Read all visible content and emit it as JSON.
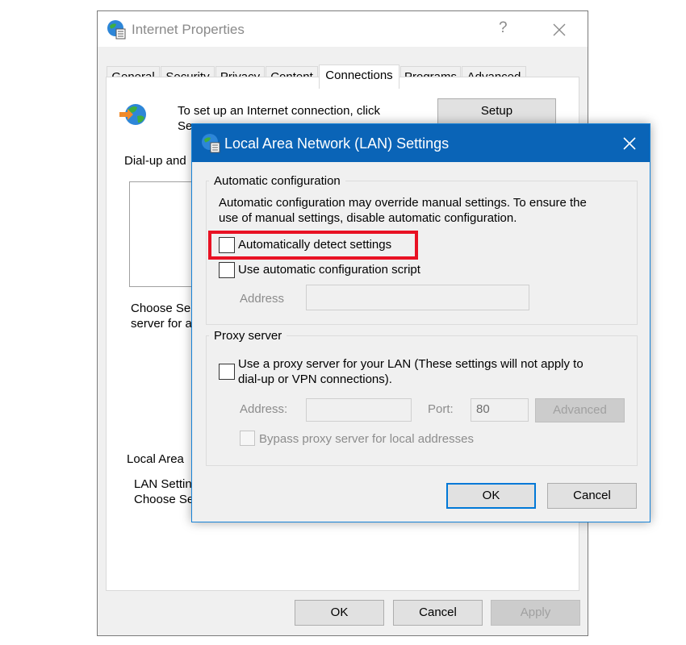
{
  "internet_properties": {
    "title": "Internet Properties",
    "help_glyph": "?",
    "tabs": [
      "General",
      "Security",
      "Privacy",
      "Content",
      "Connections",
      "Programs",
      "Advanced"
    ],
    "active_tab": "Connections",
    "setup_text_line1": "To set up an Internet connection, click",
    "setup_text_line2": "Se",
    "setup_button": "Setup",
    "dialup_label": "Dial-up and",
    "choose_text_line1": "Choose Se",
    "choose_text_line2": "server for a",
    "lan_section_label": "Local Area",
    "lan_text_line1": "LAN Settin",
    "lan_text_line2": "Choose Se",
    "ok_button": "OK",
    "cancel_button": "Cancel",
    "apply_button": "Apply"
  },
  "lan_dialog": {
    "title": "Local Area Network (LAN) Settings",
    "auto_config": {
      "legend": "Automatic configuration",
      "description_line1": "Automatic configuration may override manual settings.  To ensure the",
      "description_line2": "use of manual settings, disable automatic configuration.",
      "auto_detect_label": "Automatically detect settings",
      "auto_detect_checked": false,
      "auto_script_label": "Use automatic configuration script",
      "auto_script_checked": false,
      "address_label": "Address",
      "address_value": ""
    },
    "proxy": {
      "legend": "Proxy server",
      "use_proxy_line1": "Use a proxy server for your LAN (These settings will not apply to",
      "use_proxy_line2": "dial-up or VPN connections).",
      "use_proxy_checked": false,
      "address_label": "Address:",
      "address_value": "",
      "port_label": "Port:",
      "port_value": "80",
      "advanced_button": "Advanced",
      "bypass_label": "Bypass proxy server for local addresses",
      "bypass_checked": false
    },
    "ok_button": "OK",
    "cancel_button": "Cancel"
  },
  "colors": {
    "titlebar_blue": "#0a64b7",
    "highlight_red": "#e81123",
    "focus_blue": "#0078d7"
  },
  "icons": [
    "globe-settings-icon",
    "globe-connect-icon",
    "close-icon"
  ]
}
